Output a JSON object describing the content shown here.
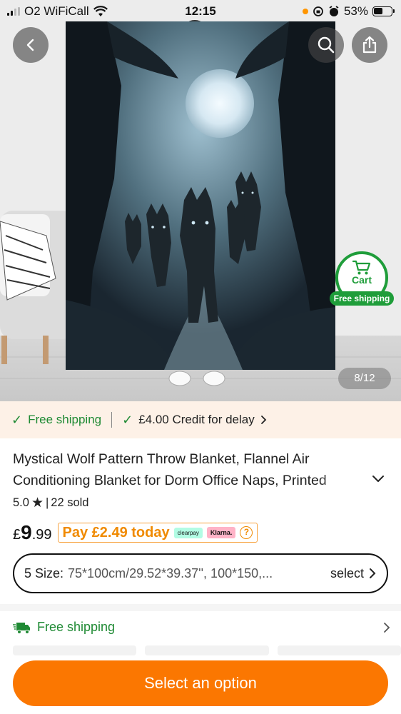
{
  "status_bar": {
    "carrier": "O2 WiFiCall",
    "time": "12:15",
    "battery": "53%",
    "battery_level": 0.53
  },
  "image": {
    "counter": "8/12"
  },
  "cart_bubble": {
    "label": "Cart",
    "badge": "Free shipping"
  },
  "promo": {
    "free_shipping": "Free shipping",
    "credit": "£4.00 Credit for delay"
  },
  "product": {
    "title_line1": "Mystical Wolf Pattern Throw Blanket, Flannel Air",
    "title_line2": "Conditioning Blanket for Dorm Office Naps, Printed",
    "rating": "5.0",
    "sold": "22 sold",
    "currency": "£",
    "price_major": "9",
    "price_minor": ".99",
    "pay_today": "Pay £2.49 today",
    "clearpay": "clearpay",
    "klarna": "Klarna."
  },
  "size_selector": {
    "label": "5 Size:",
    "value": "75*100cm/29.52*39.37'', 100*150,...",
    "action": "select"
  },
  "shipping_row": {
    "label": "Free shipping"
  },
  "cta": {
    "label": "Select an option"
  },
  "colors": {
    "accent_orange": "#fb7701",
    "green": "#1f9d3a",
    "promo_bg": "#fdf1e7"
  }
}
